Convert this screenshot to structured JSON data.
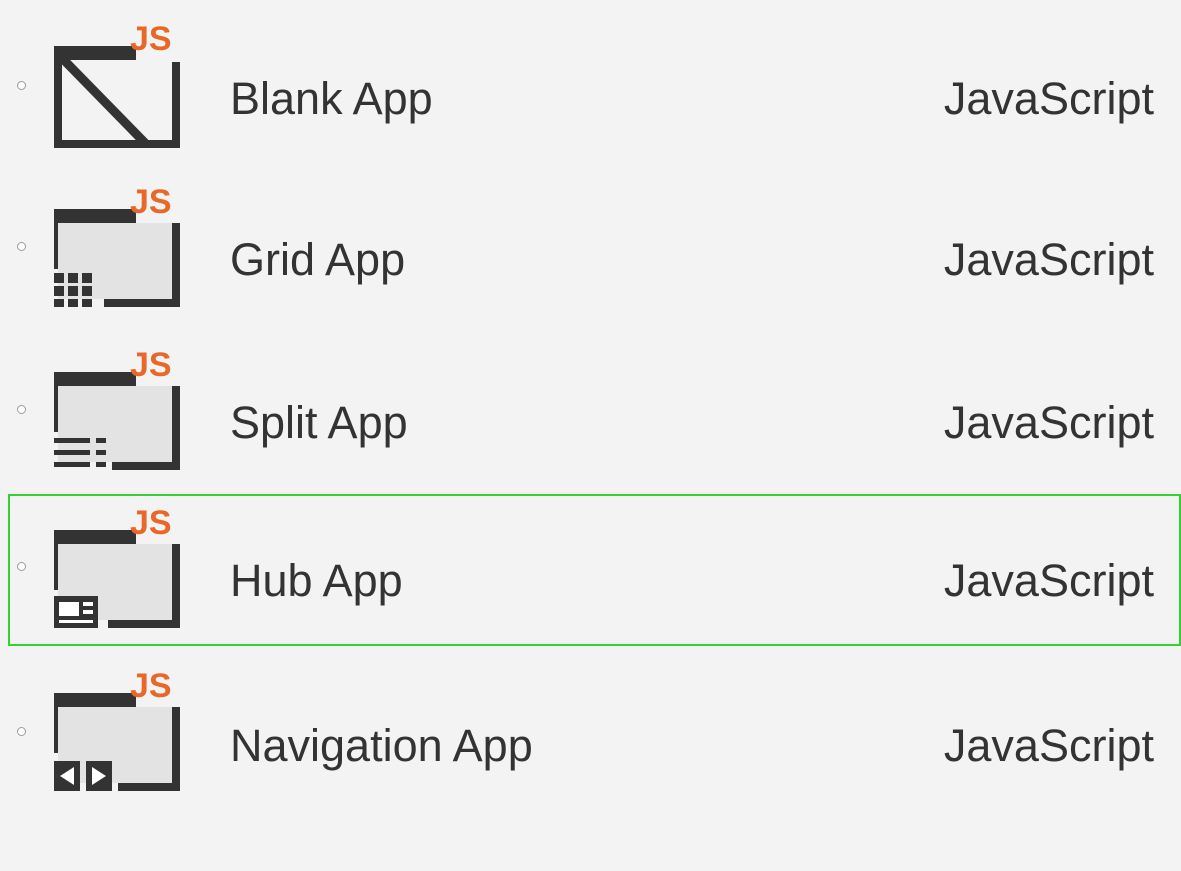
{
  "templates": [
    {
      "name": "Blank App",
      "language": "JavaScript",
      "icon": "blank-app-icon",
      "selected": false
    },
    {
      "name": "Grid App",
      "language": "JavaScript",
      "icon": "grid-app-icon",
      "selected": false
    },
    {
      "name": "Split App",
      "language": "JavaScript",
      "icon": "split-app-icon",
      "selected": false
    },
    {
      "name": "Hub App",
      "language": "JavaScript",
      "icon": "hub-app-icon",
      "selected": true
    },
    {
      "name": "Navigation App",
      "language": "JavaScript",
      "icon": "navigation-app-icon",
      "selected": false
    }
  ],
  "icon_badge": "JS",
  "colors": {
    "background": "#f3f3f3",
    "selection_border": "#34d134",
    "badge": "#e8682a",
    "icon_dark": "#333333",
    "text": "#333333"
  }
}
